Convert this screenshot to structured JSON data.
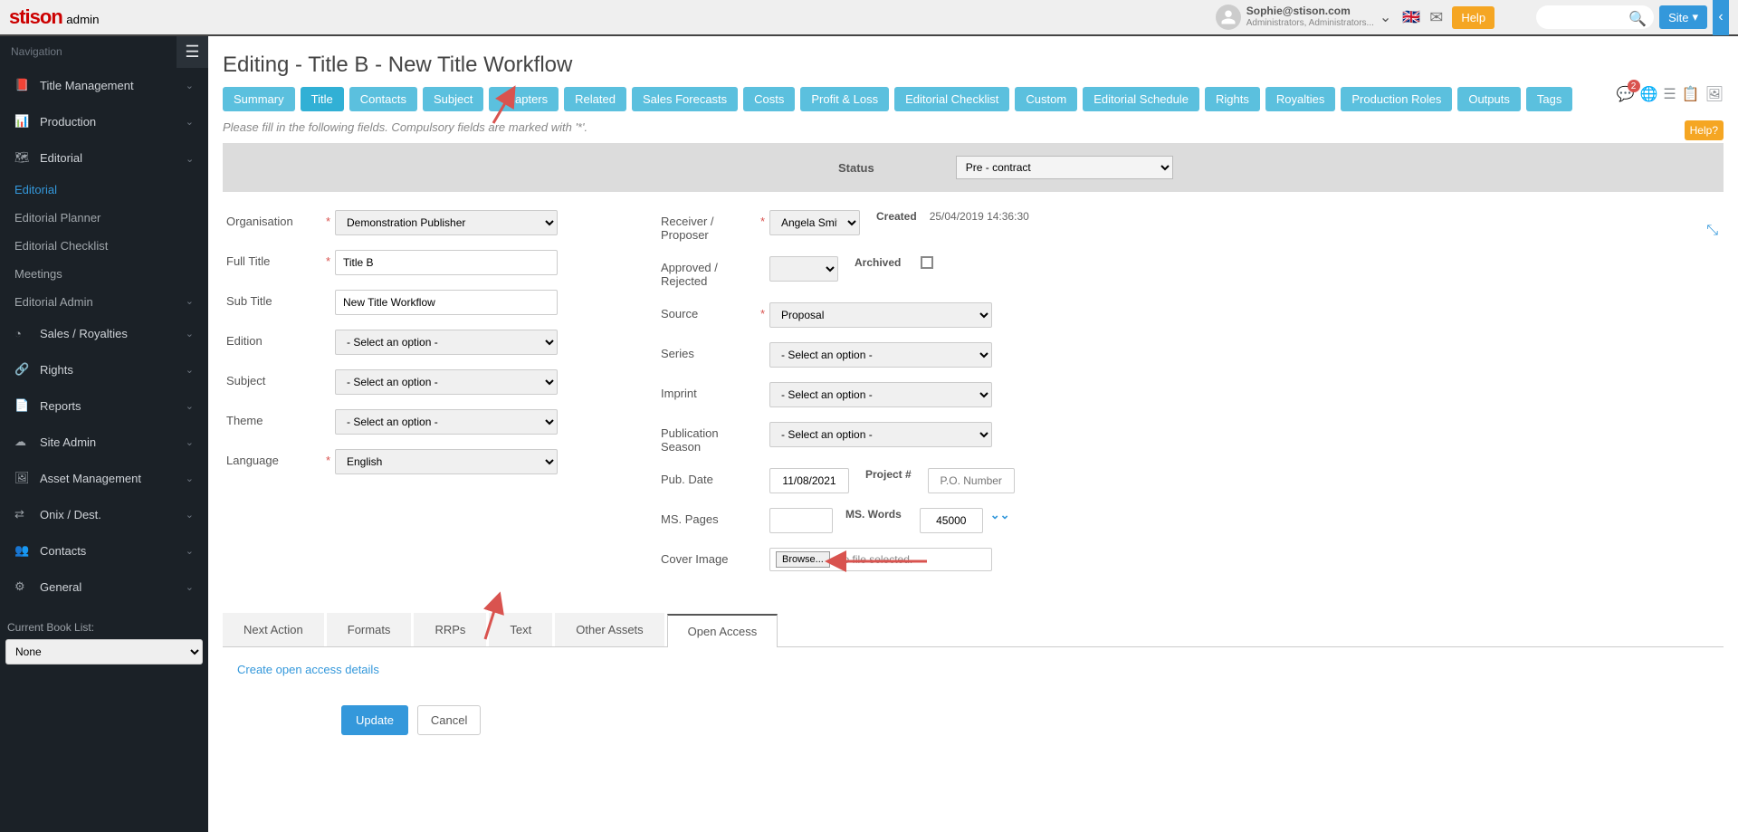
{
  "logo": {
    "name": "stison",
    "sub": "admin"
  },
  "user": {
    "email": "Sophie@stison.com",
    "role": "Administrators, Administrators..."
  },
  "help_btn": "Help",
  "site_btn": "Site",
  "search_placeholder": "",
  "badge_count": "2",
  "nav_heading": "Navigation",
  "sidebar": {
    "items": [
      {
        "label": "Title Management"
      },
      {
        "label": "Production"
      },
      {
        "label": "Editorial",
        "expanded": true,
        "children": [
          {
            "label": "Editorial",
            "active": true
          },
          {
            "label": "Editorial Planner"
          },
          {
            "label": "Editorial Checklist"
          },
          {
            "label": "Meetings"
          },
          {
            "label": "Editorial Admin",
            "has_children": true
          }
        ]
      },
      {
        "label": "Sales / Royalties"
      },
      {
        "label": "Rights"
      },
      {
        "label": "Reports"
      },
      {
        "label": "Site Admin"
      },
      {
        "label": "Asset Management"
      },
      {
        "label": "Onix / Dest."
      },
      {
        "label": "Contacts"
      },
      {
        "label": "General"
      }
    ],
    "booklist_label": "Current Book List:",
    "booklist_value": "None"
  },
  "page_title": "Editing - Title B - New Title Workflow",
  "tabs": [
    "Summary",
    "Title",
    "Contacts",
    "Subject",
    "Chapters",
    "Related",
    "Sales Forecasts",
    "Costs",
    "Profit & Loss",
    "Editorial Checklist",
    "Custom",
    "Editorial Schedule",
    "Rights",
    "Royalties",
    "Production Roles",
    "Outputs",
    "Tags"
  ],
  "active_tab": "Title",
  "compulsory_note": "Please fill in the following fields. Compulsory fields are marked with '*'.",
  "help_question": "Help?",
  "status": {
    "label": "Status",
    "value": "Pre - contract"
  },
  "form": {
    "organisation": {
      "label": "Organisation",
      "value": "Demonstration Publisher",
      "required": true
    },
    "full_title": {
      "label": "Full Title",
      "value": "Title B",
      "required": true
    },
    "sub_title": {
      "label": "Sub Title",
      "value": "New Title Workflow"
    },
    "edition": {
      "label": "Edition",
      "value": "- Select an option -"
    },
    "subject": {
      "label": "Subject",
      "value": "- Select an option -"
    },
    "theme": {
      "label": "Theme",
      "value": "- Select an option -"
    },
    "language": {
      "label": "Language",
      "value": "English",
      "required": true
    },
    "receiver": {
      "label": "Receiver / Proposer",
      "value": "Angela Smith",
      "required": true
    },
    "created_label": "Created",
    "created_value": "25/04/2019 14:36:30",
    "approved": {
      "label": "Approved / Rejected",
      "value": ""
    },
    "archived_label": "Archived",
    "source": {
      "label": "Source",
      "value": "Proposal",
      "required": true
    },
    "series": {
      "label": "Series",
      "value": "- Select an option -"
    },
    "imprint": {
      "label": "Imprint",
      "value": "- Select an option -"
    },
    "pub_season": {
      "label": "Publication Season",
      "value": "- Select an option -"
    },
    "pub_date": {
      "label": "Pub. Date",
      "value": "11/08/2021"
    },
    "project_label": "Project #",
    "project_placeholder": "P.O. Number",
    "ms_pages": {
      "label": "MS. Pages",
      "value": ""
    },
    "ms_words": {
      "label": "MS. Words",
      "value": "45000"
    },
    "cover_image": {
      "label": "Cover Image",
      "browse": "Browse...",
      "none": "No file selected."
    }
  },
  "subtabs": [
    "Next Action",
    "Formats",
    "RRPs",
    "Text",
    "Other Assets",
    "Open Access"
  ],
  "active_subtab": "Open Access",
  "open_access_link": "Create open access details",
  "update_btn": "Update",
  "cancel_btn": "Cancel"
}
